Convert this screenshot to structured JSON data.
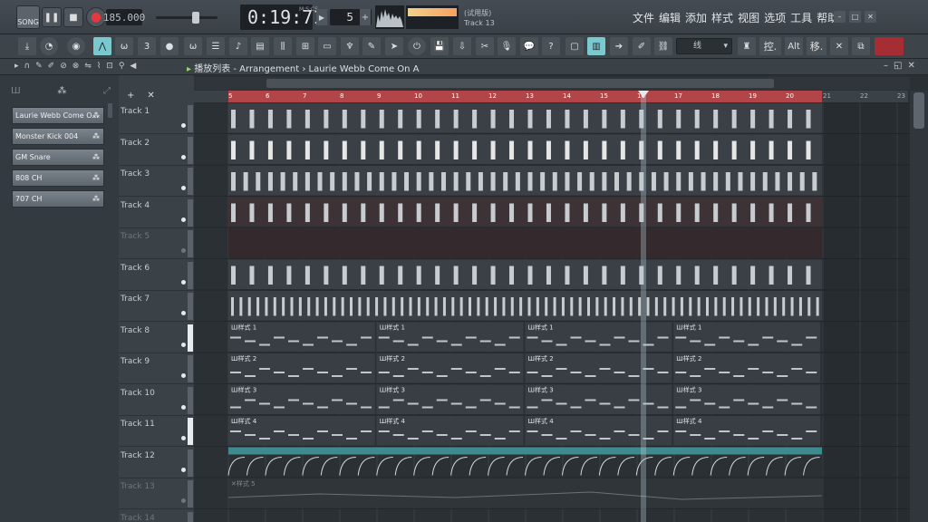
{
  "transport": {
    "song_label": "SONG",
    "tempo": "185.000",
    "time": "0:19:71",
    "time_label": "M:S:CS",
    "step": "5",
    "trial": "(试用版)",
    "current_track": "Track 13"
  },
  "menu": [
    "文件",
    "编辑",
    "添加",
    "样式",
    "视图",
    "选项",
    "工具",
    "帮助"
  ],
  "toolbar": {
    "snap_value": "线",
    "kbd_label": "控.",
    "alt_label": "Alt",
    "move_label": "移."
  },
  "playlist": {
    "breadcrumb": "播放列表 - Arrangement › Laurie Webb Come On A",
    "ruler_start": 5,
    "ruler_end": 23,
    "ruler_active_end": 20
  },
  "channels": [
    "Laurie Webb Come O...",
    "Monster Kick 004",
    "GM Snare",
    "808 CH",
    "707 CH"
  ],
  "tracks": [
    {
      "name": "Track 1",
      "muted": false
    },
    {
      "name": "Track 2",
      "muted": false
    },
    {
      "name": "Track 3",
      "muted": false
    },
    {
      "name": "Track 4",
      "muted": false
    },
    {
      "name": "Track 5",
      "muted": true
    },
    {
      "name": "Track 6",
      "muted": false
    },
    {
      "name": "Track 7",
      "muted": false
    },
    {
      "name": "Track 8",
      "muted": false
    },
    {
      "name": "Track 9",
      "muted": false
    },
    {
      "name": "Track 10",
      "muted": false
    },
    {
      "name": "Track 11",
      "muted": false
    },
    {
      "name": "Track 12",
      "muted": false
    },
    {
      "name": "Track 13",
      "muted": true
    },
    {
      "name": "Track 14",
      "muted": true
    }
  ],
  "patterns": {
    "p1": "样式 1",
    "p2": "样式 2",
    "p3": "样式 3",
    "p4": "样式 4",
    "p5": "样式 5"
  },
  "colors": {
    "ruler": "#b24548",
    "grid": "#2a3034",
    "clip": "#4a5157",
    "clip_dark": "#2d3338",
    "automation": "#3f8a8e",
    "accent": "#8be1e8"
  }
}
